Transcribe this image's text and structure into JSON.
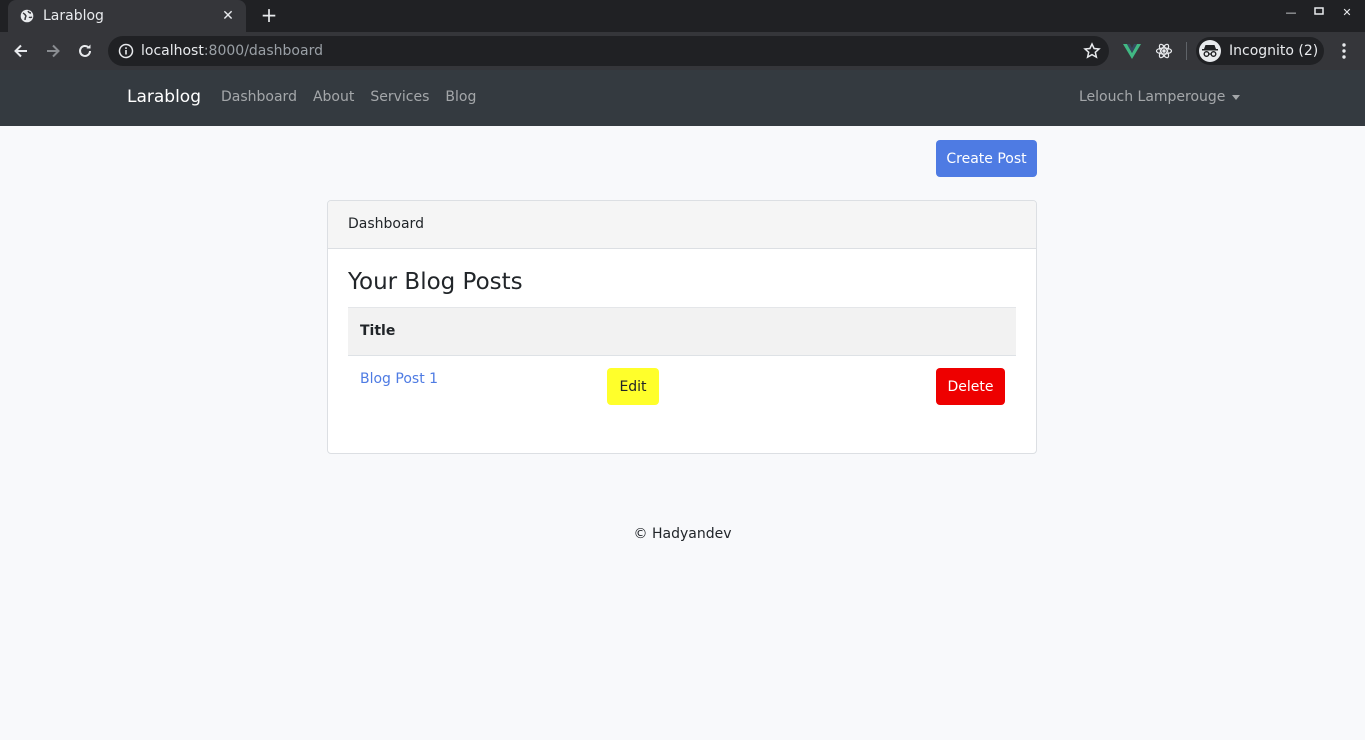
{
  "browser": {
    "tab_title": "Larablog",
    "url_host": "localhost",
    "url_path": ":8000/dashboard",
    "profile_label": "Incognito (2)"
  },
  "navbar": {
    "brand": "Larablog",
    "links": [
      "Dashboard",
      "About",
      "Services",
      "Blog"
    ],
    "user_name": "Lelouch Lamperouge"
  },
  "actions": {
    "create_post": "Create Post"
  },
  "card": {
    "header": "Dashboard",
    "title": "Your Blog Posts",
    "table_header": "Title",
    "rows": [
      {
        "title": "Blog Post 1",
        "edit_label": "Edit",
        "delete_label": "Delete"
      }
    ]
  },
  "footer": {
    "text": "© Hadyandev"
  },
  "colors": {
    "primary": "#4e7be3",
    "edit": "#ffff2b",
    "delete": "#ee0000",
    "navbar": "#343a40"
  }
}
